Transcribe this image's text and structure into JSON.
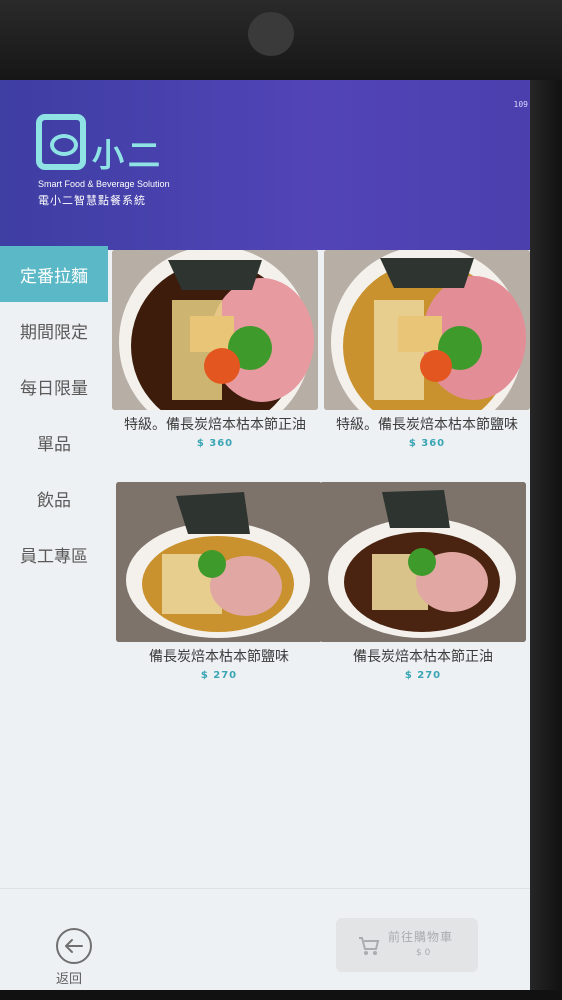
{
  "header": {
    "page_indicator": "109",
    "logo_text": "小二",
    "tagline_en": "Smart Food & Beverage Solution",
    "tagline_cn": "電小二智慧點餐系統"
  },
  "sidebar": {
    "items": [
      {
        "label": "定番拉麵",
        "active": true
      },
      {
        "label": "期間限定",
        "active": false
      },
      {
        "label": "每日限量",
        "active": false
      },
      {
        "label": "單品",
        "active": false
      },
      {
        "label": "飲品",
        "active": false
      },
      {
        "label": "員工專區",
        "active": false
      }
    ]
  },
  "menu": {
    "items": [
      {
        "name": "特級。備長炭焙本枯本節正油",
        "price": "$ 360",
        "broth": "#3d1c0c"
      },
      {
        "name": "特級。備長炭焙本枯本節鹽味",
        "price": "$ 360",
        "broth": "#c9922e"
      },
      {
        "name": "備長炭焙本枯本節鹽味",
        "price": "$ 270",
        "broth": "#c9922e"
      },
      {
        "name": "備長炭焙本枯本節正油",
        "price": "$ 270",
        "broth": "#4a2410"
      }
    ]
  },
  "footer": {
    "back_label": "返回",
    "cart_label": "前往購物車",
    "cart_total": "$ 0"
  },
  "colors": {
    "accent": "#5bb8c6",
    "header": "#4a40ae",
    "logo": "#8fe3e4"
  }
}
